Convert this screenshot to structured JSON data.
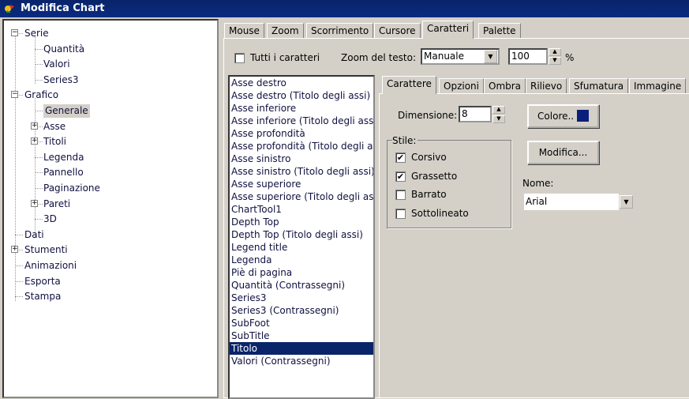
{
  "window": {
    "title": "Modifica Chart"
  },
  "tree": [
    {
      "label": "Serie",
      "level": 0,
      "expander": "minus"
    },
    {
      "label": "Quantità",
      "level": 1
    },
    {
      "label": "Valori",
      "level": 1
    },
    {
      "label": "Series3",
      "level": 1
    },
    {
      "label": "Grafico",
      "level": 0,
      "expander": "minus"
    },
    {
      "label": "Generale",
      "level": 1,
      "selected": true
    },
    {
      "label": "Asse",
      "level": 1,
      "expander": "plus"
    },
    {
      "label": "Titoli",
      "level": 1,
      "expander": "plus"
    },
    {
      "label": "Legenda",
      "level": 1
    },
    {
      "label": "Pannello",
      "level": 1
    },
    {
      "label": "Paginazione",
      "level": 1
    },
    {
      "label": "Pareti",
      "level": 1,
      "expander": "plus"
    },
    {
      "label": "3D",
      "level": 1
    },
    {
      "label": "Dati",
      "level": 0
    },
    {
      "label": "Stumenti",
      "level": 0,
      "expander": "plus"
    },
    {
      "label": "Animazioni",
      "level": 0
    },
    {
      "label": "Esporta",
      "level": 0
    },
    {
      "label": "Stampa",
      "level": 0
    }
  ],
  "main_tabs": [
    "Mouse",
    "Zoom",
    "Scorrimento",
    "Cursore",
    "Caratteri",
    "Palette"
  ],
  "main_tab_active": "Caratteri",
  "toolbar": {
    "all_fonts_label": "Tutti i caratteri",
    "all_fonts_checked": false,
    "zoom_label": "Zoom del testo:",
    "zoom_mode": "Manuale",
    "zoom_value": "100",
    "percent": "%"
  },
  "list_items": [
    "Asse destro",
    "Asse destro (Titolo degli assi)",
    "Asse inferiore",
    "Asse inferiore (Titolo degli assi)",
    "Asse profondità",
    "Asse profondità (Titolo degli assi)",
    "Asse sinistro",
    "Asse sinistro (Titolo degli assi)",
    "Asse superiore",
    "Asse superiore (Titolo degli assi)",
    "ChartTool1",
    "Depth Top",
    "Depth Top (Titolo degli assi)",
    "Legend title",
    "Legenda",
    "Piè di pagina",
    "Quantità (Contrassegni)",
    "Series3",
    "Series3 (Contrassegni)",
    "SubFoot",
    "SubTitle",
    "Titolo",
    "Valori (Contrassegni)"
  ],
  "list_selected": "Titolo",
  "inner_tabs": [
    "Carattere",
    "Opzioni",
    "Ombra",
    "Rilievo",
    "Sfumatura",
    "Immagine"
  ],
  "inner_tab_active": "Carattere",
  "font": {
    "size_label": "Dimensione:",
    "size": "8",
    "color_button": "Colore..",
    "color": "#0a1f7a",
    "style_label": "Stile:",
    "styles": [
      {
        "label": "Corsivo",
        "checked": true
      },
      {
        "label": "Grassetto",
        "checked": true
      },
      {
        "label": "Barrato",
        "checked": false
      },
      {
        "label": "Sottolineato",
        "checked": false
      }
    ],
    "modify_button": "Modifica...",
    "name_label": "Nome:",
    "name": "Arial"
  }
}
